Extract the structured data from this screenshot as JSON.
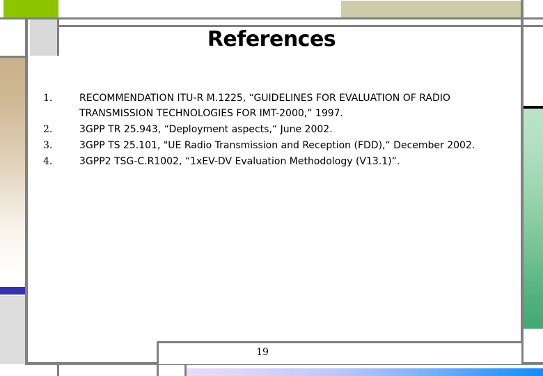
{
  "slide": {
    "title": "References",
    "page_number": "19",
    "colors": {
      "green_block": "#8CC600",
      "gray_box": "#D9D9D9",
      "tan_column_top": "#C9B08D",
      "blue_bar": "#3333B5",
      "gray_column": "#DDDDDD",
      "khaki_block": "#CDCBA8",
      "green_column_top": "#BCE3C8",
      "green_column_bottom": "#44A873",
      "bottom_bar_left": "#EADCF6",
      "bottom_bar_right": "#0D8CFD",
      "rule": "#808080",
      "text": "#000000"
    }
  },
  "references": [
    {
      "number": "1.",
      "text": "RECOMMENDATION ITU-R M.1225, “GUIDELINES  FOR  EVALUATION OF  RADIO TRANSMISSION TECHNOLOGIES  FOR  IMT-2000,” 1997."
    },
    {
      "number": "2.",
      "text": "3GPP TR 25.943, “Deployment aspects,“ June 2002."
    },
    {
      "number": "3.",
      "text": "3GPP TS 25.101, \"UE Radio Transmission and Reception (FDD),“ December 2002."
    },
    {
      "number": "4.",
      "text": "3GPP2 TSG-C.R1002, “1xEV-DV Evaluation Methodology (V13.1)”."
    }
  ]
}
